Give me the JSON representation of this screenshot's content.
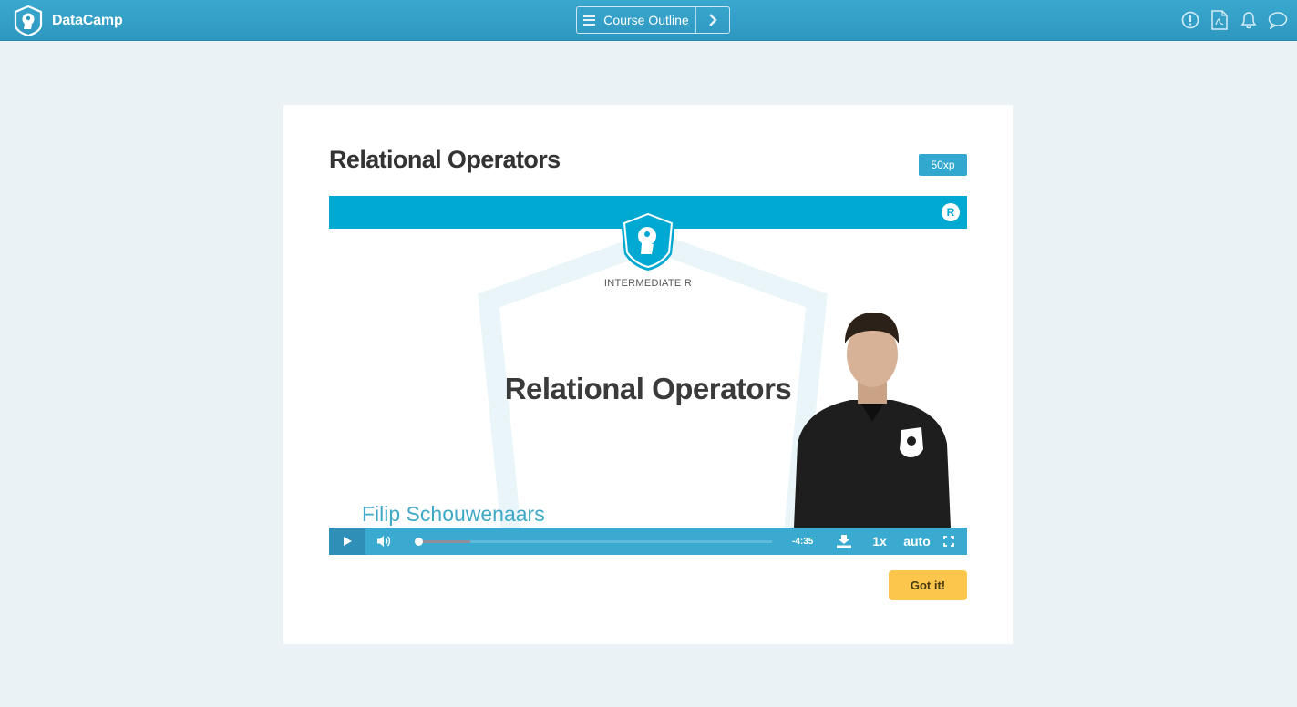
{
  "app": {
    "name": "DataCamp",
    "logo_icon": "datacamp-logo-icon"
  },
  "header": {
    "course_outline_label": "Course Outline",
    "next_icon": "chevron-right-icon",
    "icons": [
      "alert-icon",
      "pdf-icon",
      "bell-icon",
      "chat-icon"
    ]
  },
  "exercise": {
    "title": "Relational Operators",
    "xp": "50xp",
    "submit_label": "Got it!"
  },
  "video": {
    "course_label": "INTERMEDIATE R",
    "slide_title": "Relational Operators",
    "presenter_name": "Filip Schouwenaars",
    "r_badge": "R",
    "time_remaining": "-4:35",
    "speed": "1x",
    "quality": "auto",
    "progress_fraction": 0.0,
    "buffered_fraction": 0.155
  },
  "colors": {
    "topbar": "#2e97c0",
    "accent": "#33a8cf",
    "video_band": "#00a9d1",
    "button_yellow": "#fcc54b",
    "page_bg": "#ebf2f5"
  }
}
